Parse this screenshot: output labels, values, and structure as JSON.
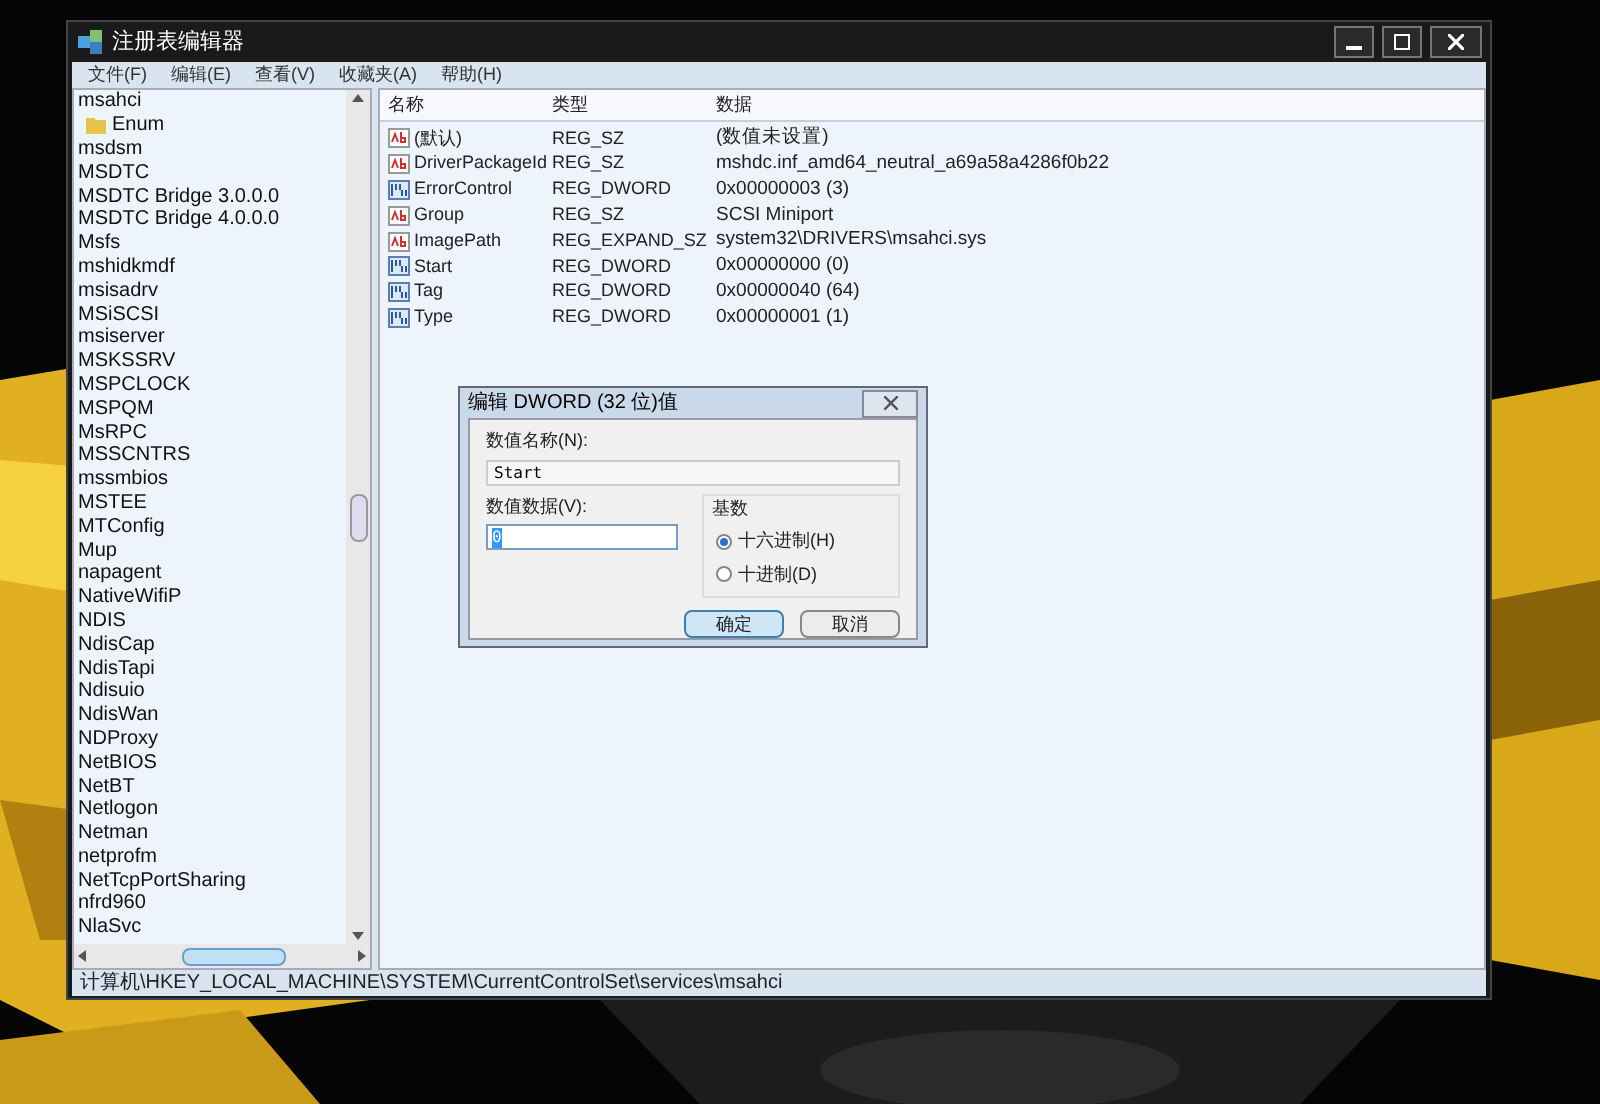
{
  "window": {
    "title": "注册表编辑器"
  },
  "menu": [
    "文件(F)",
    "编辑(E)",
    "查看(V)",
    "收藏夹(A)",
    "帮助(H)"
  ],
  "tree": [
    {
      "label": "msahci",
      "children": [
        {
          "label": "Enum"
        }
      ]
    },
    {
      "label": "msdsm"
    },
    {
      "label": "MSDTC"
    },
    {
      "label": "MSDTC Bridge 3.0.0.0"
    },
    {
      "label": "MSDTC Bridge 4.0.0.0"
    },
    {
      "label": "Msfs"
    },
    {
      "label": "mshidkmdf"
    },
    {
      "label": "msisadrv"
    },
    {
      "label": "MSiSCSI"
    },
    {
      "label": "msiserver"
    },
    {
      "label": "MSKSSRV"
    },
    {
      "label": "MSPCLOCK"
    },
    {
      "label": "MSPQM"
    },
    {
      "label": "MsRPC"
    },
    {
      "label": "MSSCNTRS"
    },
    {
      "label": "mssmbios"
    },
    {
      "label": "MSTEE"
    },
    {
      "label": "MTConfig"
    },
    {
      "label": "Mup"
    },
    {
      "label": "napagent"
    },
    {
      "label": "NativeWifiP"
    },
    {
      "label": "NDIS"
    },
    {
      "label": "NdisCap"
    },
    {
      "label": "NdisTapi"
    },
    {
      "label": "Ndisuio"
    },
    {
      "label": "NdisWan"
    },
    {
      "label": "NDProxy"
    },
    {
      "label": "NetBIOS"
    },
    {
      "label": "NetBT"
    },
    {
      "label": "Netlogon"
    },
    {
      "label": "Netman"
    },
    {
      "label": "netprofm"
    },
    {
      "label": "NetTcpPortSharing"
    },
    {
      "label": "nfrd960"
    },
    {
      "label": "NlaSvc"
    }
  ],
  "values": {
    "columns": [
      "名称",
      "类型",
      "数据"
    ],
    "rows": [
      {
        "kind": "string",
        "name": "(默认)",
        "type": "REG_SZ",
        "data": "(数值未设置)"
      },
      {
        "kind": "string",
        "name": "DriverPackageId",
        "type": "REG_SZ",
        "data": "mshdc.inf_amd64_neutral_a69a58a4286f0b22"
      },
      {
        "kind": "binary",
        "name": "ErrorControl",
        "type": "REG_DWORD",
        "data": "0x00000003 (3)"
      },
      {
        "kind": "string",
        "name": "Group",
        "type": "REG_SZ",
        "data": "SCSI Miniport"
      },
      {
        "kind": "string",
        "name": "ImagePath",
        "type": "REG_EXPAND_SZ",
        "data": "system32\\DRIVERS\\msahci.sys"
      },
      {
        "kind": "binary",
        "name": "Start",
        "type": "REG_DWORD",
        "data": "0x00000000 (0)"
      },
      {
        "kind": "binary",
        "name": "Tag",
        "type": "REG_DWORD",
        "data": "0x00000040 (64)"
      },
      {
        "kind": "binary",
        "name": "Type",
        "type": "REG_DWORD",
        "data": "0x00000001 (1)"
      }
    ]
  },
  "status_bar": "计算机\\HKEY_LOCAL_MACHINE\\SYSTEM\\CurrentControlSet\\services\\msahci",
  "dialog": {
    "title": "编辑 DWORD (32 位)值",
    "name_label": "数值名称(N):",
    "name_value": "Start",
    "data_label": "数值数据(V):",
    "data_value": "0",
    "base_label": "基数",
    "bases": [
      {
        "label": "十六进制(H)",
        "selected": true
      },
      {
        "label": "十进制(D)",
        "selected": false
      }
    ],
    "buttons": [
      {
        "label": "确定",
        "default": true
      },
      {
        "label": "取消",
        "default": false
      }
    ]
  }
}
